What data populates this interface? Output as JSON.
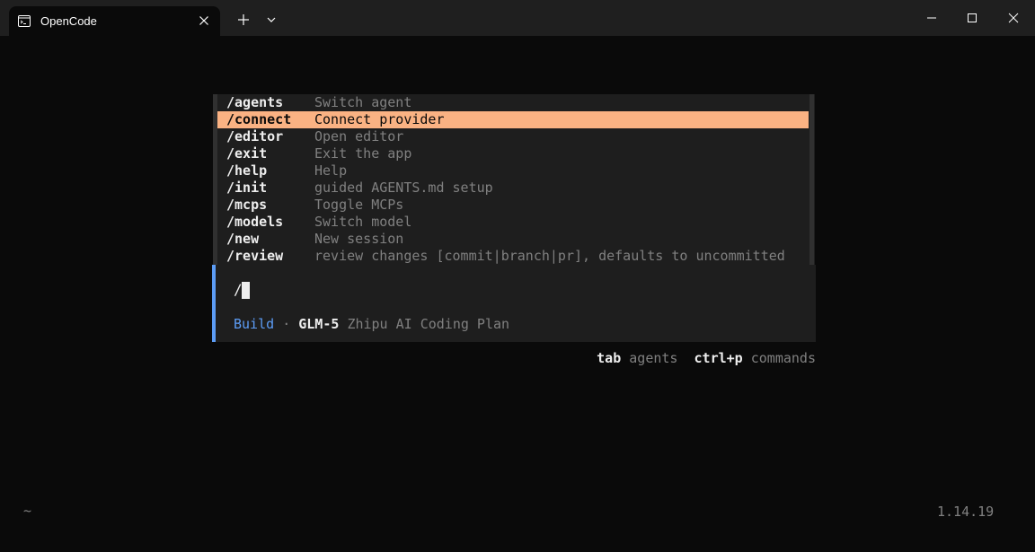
{
  "window": {
    "tab_title": "OpenCode"
  },
  "commands": [
    {
      "name": "/agents",
      "desc": "Switch agent",
      "selected": false
    },
    {
      "name": "/connect",
      "desc": "Connect provider",
      "selected": true
    },
    {
      "name": "/editor",
      "desc": "Open editor",
      "selected": false
    },
    {
      "name": "/exit",
      "desc": "Exit the app",
      "selected": false
    },
    {
      "name": "/help",
      "desc": "Help",
      "selected": false
    },
    {
      "name": "/init",
      "desc": "guided AGENTS.md setup",
      "selected": false
    },
    {
      "name": "/mcps",
      "desc": "Toggle MCPs",
      "selected": false
    },
    {
      "name": "/models",
      "desc": "Switch model",
      "selected": false
    },
    {
      "name": "/new",
      "desc": "New session",
      "selected": false
    },
    {
      "name": "/review",
      "desc": "review changes [commit|branch|pr], defaults to uncommitted",
      "selected": false
    }
  ],
  "input": {
    "value": "/"
  },
  "status": {
    "mode": "Build",
    "separator": "·",
    "model": "GLM-5",
    "provider": "Zhipu AI Coding Plan"
  },
  "hints": {
    "tab_key": "tab",
    "tab_label": "agents",
    "cmd_key": "ctrl+p",
    "cmd_label": "commands"
  },
  "footer": {
    "cwd": "~",
    "version": "1.14.19"
  },
  "colors": {
    "accent": "#fab283",
    "mode": "#5c9cf5",
    "background": "#0a0a0a"
  }
}
